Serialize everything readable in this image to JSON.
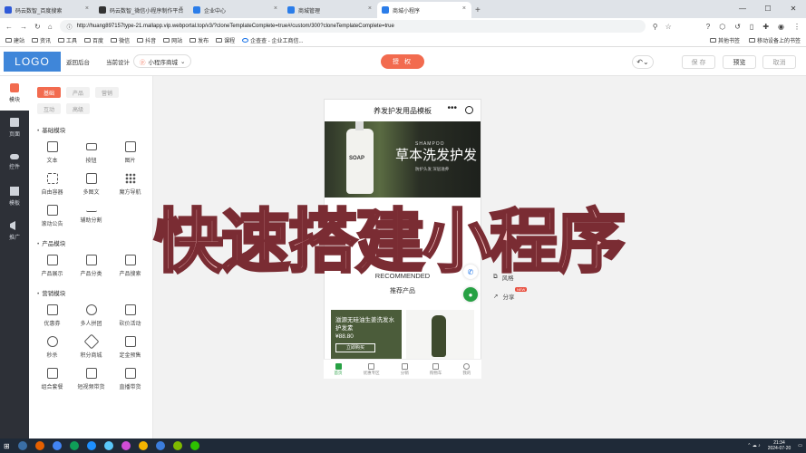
{
  "browser": {
    "tabs": [
      {
        "label": "码云数智_百度搜索",
        "color": "#2f5ad8"
      },
      {
        "label": "码云数智_微信小程序制作平台",
        "color": "#333333"
      },
      {
        "label": "企业中心",
        "color": "#2b7de9"
      },
      {
        "label": "商城管理",
        "color": "#2b7de9"
      },
      {
        "label": "商城小程序",
        "color": "#2b7de9"
      }
    ],
    "url": "http://huang897157type-21.mallapp.vip.webportal.top/v3/?cloneTemplateComplete=true#/custom/300?cloneTemplateComplete=true",
    "bookmarks": [
      "建站",
      "资讯",
      "工具",
      "百度",
      "微信",
      "抖音",
      "网站",
      "发布",
      "课程",
      "企查查 - 企业工商信..."
    ],
    "bookmarks_right": [
      "其他书签",
      "移动设备上的书签"
    ]
  },
  "editor": {
    "logo": "LOGO",
    "back_label": "返回后台",
    "current_design_label": "当前设计",
    "current_design_value": "小程序商城",
    "auth_button": "授 权",
    "save": "保 存",
    "preview": "预览",
    "cancel": "取消"
  },
  "sidebar": [
    {
      "label": "模块",
      "active": true
    },
    {
      "label": "页面",
      "active": false
    },
    {
      "label": "控件",
      "active": false
    },
    {
      "label": "模板",
      "active": false
    },
    {
      "label": "推广",
      "active": false
    }
  ],
  "panel": {
    "tabs": [
      "基础",
      "产品",
      "营销",
      "互动",
      "高级"
    ],
    "sections": [
      {
        "title": "基础模块",
        "items": [
          "文本",
          "按钮",
          "图片",
          "自由容器",
          "多图文",
          "魔方导航",
          "滚动公告",
          "辅助分割"
        ]
      },
      {
        "title": "产品模块",
        "items": [
          "产品展示",
          "产品分类",
          "产品搜索"
        ]
      },
      {
        "title": "营销模块",
        "items": [
          "优惠券",
          "多人拼团",
          "砍价活动",
          "秒杀",
          "积分商城",
          "定金预售",
          "组合套餐",
          "短视频带货",
          "直播带货"
        ]
      }
    ]
  },
  "phone": {
    "title": "养发护发用品模板",
    "banner_title": "草本洗发护发",
    "banner_shampoo": "SHAMPOO",
    "banner_sub": "防护头发 深层滋养",
    "bottle_label": "SOAP",
    "recommended_en": "RECOMMENDED",
    "recommended_cn": "推荐产品",
    "product_name": "滋源无硅油生姜洗发水护发素",
    "product_price": "¥88.80",
    "product_button": "立即购买",
    "tabs": [
      {
        "label": "首页",
        "active": true
      },
      {
        "label": "优惠专区",
        "active": false
      },
      {
        "label": "分销",
        "active": false
      },
      {
        "label": "购物车",
        "active": false
      },
      {
        "label": "我的",
        "active": false
      }
    ]
  },
  "side_actions": [
    "风格",
    "分享"
  ],
  "new_badge": "NEW",
  "overlay_text": "快速搭建小程序",
  "taskbar": {
    "time": "21:34",
    "date": "2024-07-20"
  },
  "colors": {
    "accent": "#f26b4f",
    "logo": "#3f86d9",
    "sidebar": "#2d3037"
  }
}
